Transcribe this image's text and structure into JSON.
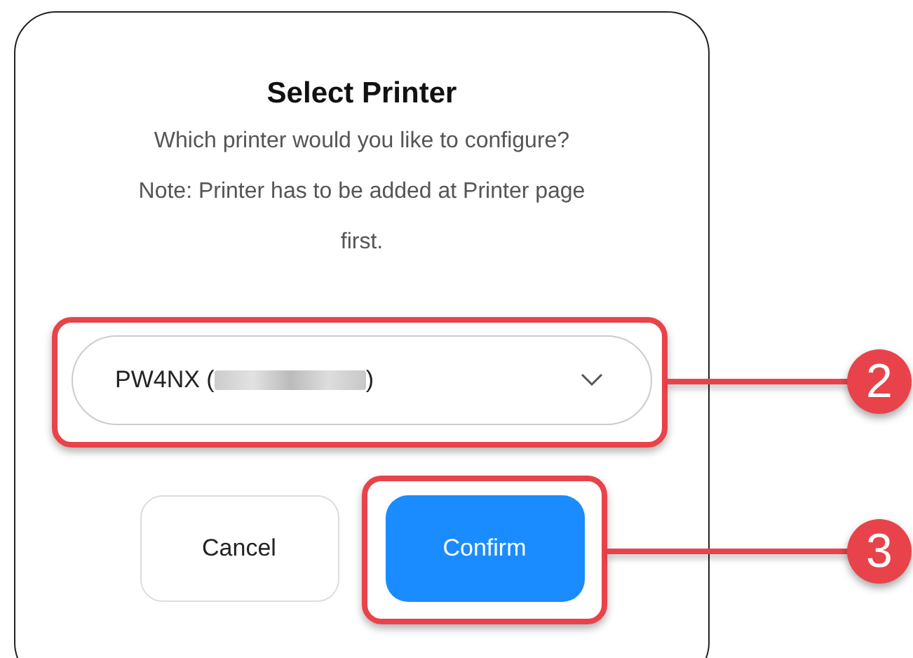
{
  "dialog": {
    "title": "Select Printer",
    "question": "Which printer would you like to configure?",
    "note": "Note: Printer has to be added at Printer page first.",
    "printer_select": {
      "value_start": "PW4NX (",
      "value_end": ")"
    },
    "buttons": [
      {
        "label": "Cancel",
        "kind": "secondary"
      },
      {
        "label": "Confirm",
        "kind": "primary"
      }
    ]
  },
  "callouts": [
    {
      "number": "2"
    },
    {
      "number": "3"
    }
  ]
}
